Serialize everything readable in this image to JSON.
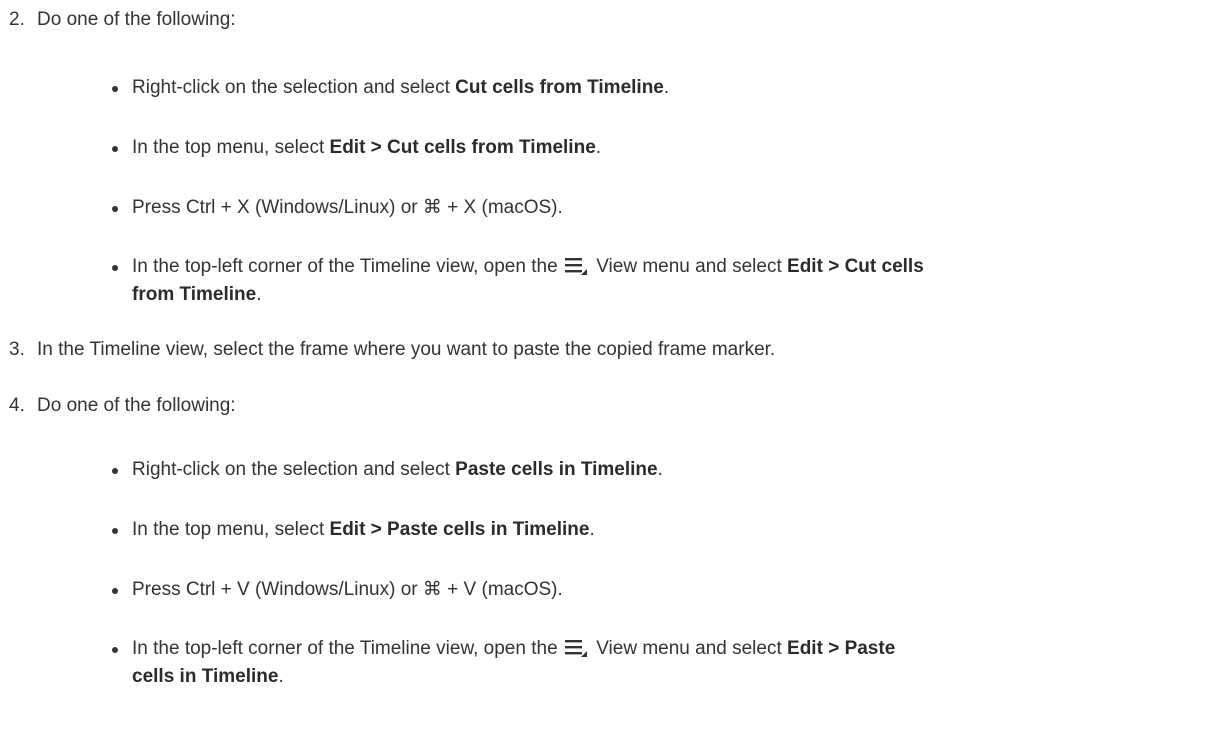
{
  "steps": [
    {
      "num": "2.",
      "text": "Do one of the following:",
      "bullets": [
        {
          "pre": "Right-click on the selection and select ",
          "bold": "Cut cells from Timeline",
          "post": "."
        },
        {
          "pre": "In the top menu, select ",
          "bold": "Edit > Cut cells from Timeline",
          "post": "."
        },
        {
          "pre": "Press Ctrl + X (Windows/Linux) or ⌘ + X (macOS).",
          "bold": "",
          "post": ""
        },
        {
          "pre": "In the top-left corner of the Timeline view, open the ",
          "icon": "view-menu-icon",
          "mid": " View menu and select ",
          "bold": "Edit > Cut cells",
          "line2_bold": "from Timeline",
          "post": "."
        }
      ]
    },
    {
      "num": "3.",
      "text": "In the Timeline view, select the frame where you want to paste the copied frame marker."
    },
    {
      "num": "4.",
      "text": "Do one of the following:",
      "bullets": [
        {
          "pre": "Right-click on the selection and select ",
          "bold": "Paste cells in Timeline",
          "post": "."
        },
        {
          "pre": "In the top menu, select ",
          "bold": "Edit > Paste cells in Timeline",
          "post": "."
        },
        {
          "pre": "Press Ctrl + V (Windows/Linux) or ⌘ + V (macOS).",
          "bold": "",
          "post": ""
        },
        {
          "pre": "In the top-left corner of the Timeline view, open the ",
          "icon": "view-menu-icon",
          "mid": " View menu and select ",
          "bold": "Edit > Paste",
          "line2_bold": "cells in Timeline",
          "post": "."
        }
      ]
    }
  ]
}
